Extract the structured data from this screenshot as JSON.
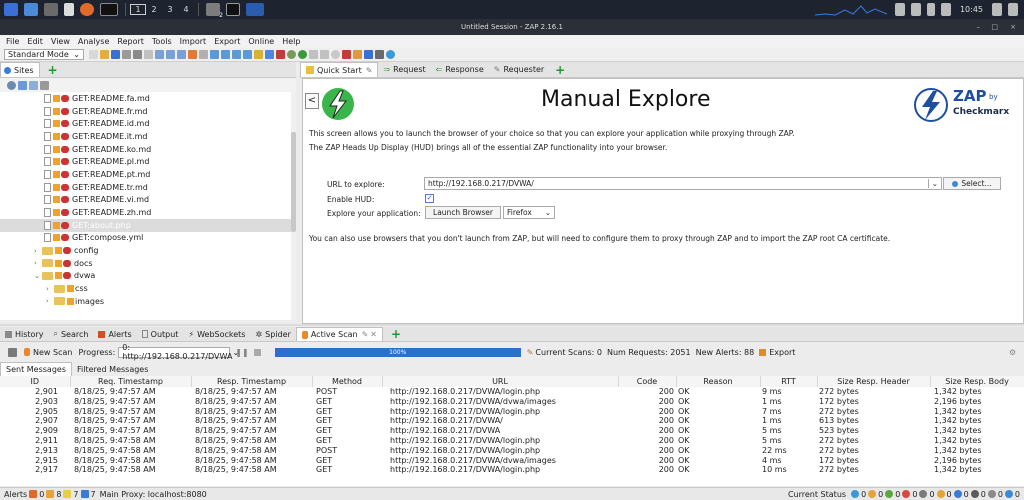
{
  "taskbar": {
    "workspaces": [
      "1",
      "2",
      "3",
      "4"
    ],
    "clock": "10:45",
    "active_count": "2"
  },
  "window": {
    "title": "Untitled Session - ZAP 2.16.1"
  },
  "menu": [
    "File",
    "Edit",
    "View",
    "Analyse",
    "Report",
    "Tools",
    "Import",
    "Export",
    "Online",
    "Help"
  ],
  "mode": "Standard Mode",
  "sites_tab": "Sites",
  "tree": [
    {
      "indent": 1,
      "type": "req",
      "label": "GET:README.fa.md"
    },
    {
      "indent": 1,
      "type": "req",
      "label": "GET:README.fr.md"
    },
    {
      "indent": 1,
      "type": "req",
      "label": "GET:README.id.md"
    },
    {
      "indent": 1,
      "type": "req",
      "label": "GET:README.it.md"
    },
    {
      "indent": 1,
      "type": "req",
      "label": "GET:README.ko.md"
    },
    {
      "indent": 1,
      "type": "req",
      "label": "GET:README.pl.md"
    },
    {
      "indent": 1,
      "type": "req",
      "label": "GET:README.pt.md"
    },
    {
      "indent": 1,
      "type": "req",
      "label": "GET:README.tr.md"
    },
    {
      "indent": 1,
      "type": "req",
      "label": "GET:README.vi.md"
    },
    {
      "indent": 1,
      "type": "req",
      "label": "GET:README.zh.md"
    },
    {
      "indent": 1,
      "type": "req",
      "label": "GET:about.php",
      "selected": true
    },
    {
      "indent": 1,
      "type": "req",
      "label": "GET:compose.yml"
    },
    {
      "indent": 0,
      "type": "folder",
      "label": "config"
    },
    {
      "indent": 0,
      "type": "folder",
      "label": "docs"
    },
    {
      "indent": 0,
      "type": "folder",
      "label": "dvwa",
      "open": true
    },
    {
      "indent": 1,
      "type": "folder",
      "label": "css"
    },
    {
      "indent": 1,
      "type": "folder",
      "label": "images"
    }
  ],
  "workspace_tabs": [
    "Quick Start",
    "Request",
    "Response",
    "Requester"
  ],
  "quickstart": {
    "back": "<",
    "title": "Manual Explore",
    "logo_main": "ZAP",
    "logo_by": "by",
    "logo_brand": "Checkmarx",
    "desc1": "This screen allows you to launch the browser of your choice so that you can explore your application while proxying through ZAP.",
    "desc2": "The ZAP Heads Up Display (HUD) brings all of the essential ZAP functionality into your browser.",
    "url_label": "URL to explore:",
    "url_value": "http://192.168.0.217/DVWA/",
    "select_btn": "Select...",
    "hud_label": "Enable HUD:",
    "explore_label": "Explore your application:",
    "launch_btn": "Launch Browser",
    "browser": "Firefox",
    "note": "You can also use browsers that you don't launch from ZAP, but will need to configure them to proxy through ZAP and to import the ZAP root CA certificate."
  },
  "bottom_tabs": [
    "History",
    "Search",
    "Alerts",
    "Output",
    "WebSockets",
    "Spider",
    "Active Scan"
  ],
  "scan": {
    "new_scan": "New Scan",
    "progress_label": "Progress:",
    "progress_target": "0: http://192.168.0.217/DVWA",
    "progress": 1.0,
    "progress_text": "100%",
    "current_scans": "Current Scans: 0",
    "requests": "Num Requests: 2051",
    "alerts": "New Alerts: 88",
    "export": "Export"
  },
  "msg_tabs": [
    "Sent Messages",
    "Filtered Messages"
  ],
  "columns": [
    "ID",
    "Req. Timestamp",
    "Resp. Timestamp",
    "Method",
    "URL",
    "Code",
    "Reason",
    "RTT",
    "Size Resp. Header",
    "Size Resp. Body"
  ],
  "rows": [
    [
      "2,901",
      "8/18/25, 9:47:57 AM",
      "8/18/25, 9:47:57 AM",
      "POST",
      "http://192.168.0.217/DVWA/login.php",
      "200",
      "OK",
      "9 ms",
      "272 bytes",
      "1,342 bytes"
    ],
    [
      "2,903",
      "8/18/25, 9:47:57 AM",
      "8/18/25, 9:47:57 AM",
      "GET",
      "http://192.168.0.217/DVWA/dvwa/images",
      "200",
      "OK",
      "1 ms",
      "172 bytes",
      "2,196 bytes"
    ],
    [
      "2,905",
      "8/18/25, 9:47:57 AM",
      "8/18/25, 9:47:57 AM",
      "GET",
      "http://192.168.0.217/DVWA/login.php",
      "200",
      "OK",
      "7 ms",
      "272 bytes",
      "1,342 bytes"
    ],
    [
      "2,907",
      "8/18/25, 9:47:57 AM",
      "8/18/25, 9:47:57 AM",
      "GET",
      "http://192.168.0.217/DVWA/",
      "200",
      "OK",
      "1 ms",
      "613 bytes",
      "1,342 bytes"
    ],
    [
      "2,909",
      "8/18/25, 9:47:57 AM",
      "8/18/25, 9:47:57 AM",
      "GET",
      "http://192.168.0.217/DVWA",
      "200",
      "OK",
      "5 ms",
      "523 bytes",
      "1,342 bytes"
    ],
    [
      "2,911",
      "8/18/25, 9:47:58 AM",
      "8/18/25, 9:47:58 AM",
      "GET",
      "http://192.168.0.217/DVWA/login.php",
      "200",
      "OK",
      "5 ms",
      "272 bytes",
      "1,342 bytes"
    ],
    [
      "2,913",
      "8/18/25, 9:47:58 AM",
      "8/18/25, 9:47:58 AM",
      "POST",
      "http://192.168.0.217/DVWA/login.php",
      "200",
      "OK",
      "22 ms",
      "272 bytes",
      "1,342 bytes"
    ],
    [
      "2,915",
      "8/18/25, 9:47:58 AM",
      "8/18/25, 9:47:58 AM",
      "GET",
      "http://192.168.0.217/DVWA/dvwa/images",
      "200",
      "OK",
      "4 ms",
      "172 bytes",
      "2,196 bytes"
    ],
    [
      "2,917",
      "8/18/25, 9:47:58 AM",
      "8/18/25, 9:47:58 AM",
      "GET",
      "http://192.168.0.217/DVWA/login.php",
      "200",
      "OK",
      "10 ms",
      "272 bytes",
      "1,342 bytes"
    ]
  ],
  "status": {
    "alerts_label": "Alerts",
    "a1": "0",
    "a2": "8",
    "a3": "7",
    "a4": "7",
    "proxy": "Main Proxy: localhost:8080",
    "current_status": "Current Status",
    "c": [
      "0",
      "0",
      "0",
      "0",
      "0",
      "0",
      "0",
      "0",
      "0",
      "0"
    ]
  }
}
